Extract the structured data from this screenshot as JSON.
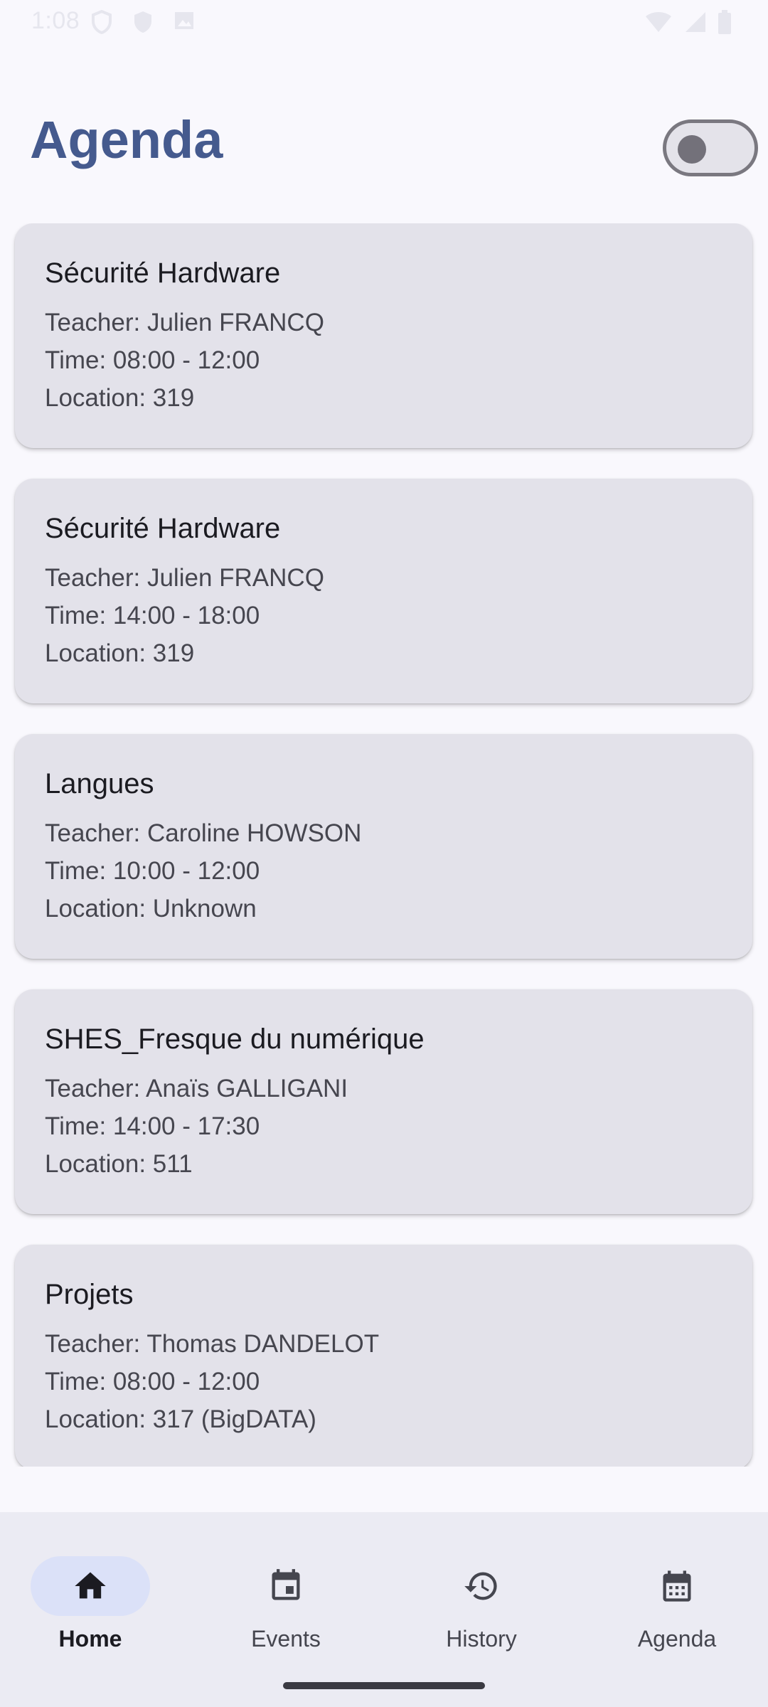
{
  "status_bar": {
    "time": "1:08"
  },
  "header": {
    "title": "Agenda"
  },
  "toggle": {
    "state": "off"
  },
  "events": [
    {
      "title": "Sécurité Hardware",
      "teacher": "Teacher: Julien FRANCQ",
      "time": "Time: 08:00 - 12:00",
      "location": "Location: 319"
    },
    {
      "title": "Sécurité Hardware",
      "teacher": "Teacher: Julien FRANCQ",
      "time": "Time: 14:00 - 18:00",
      "location": "Location: 319"
    },
    {
      "title": "Langues",
      "teacher": "Teacher: Caroline HOWSON",
      "time": "Time: 10:00 - 12:00",
      "location": "Location: Unknown"
    },
    {
      "title": "SHES_Fresque du numérique",
      "teacher": "Teacher: Anaïs GALLIGANI",
      "time": "Time: 14:00 - 17:30",
      "location": "Location: 511"
    },
    {
      "title": "Projets",
      "teacher": "Teacher: Thomas DANDELOT",
      "time": "Time: 08:00 - 12:00",
      "location": "Location: 317 (BigDATA)"
    }
  ],
  "bottom_nav": {
    "items": [
      {
        "label": "Home",
        "icon": "home-icon",
        "active": true
      },
      {
        "label": "Events",
        "icon": "calendar-event-icon",
        "active": false
      },
      {
        "label": "History",
        "icon": "history-icon",
        "active": false
      },
      {
        "label": "Agenda",
        "icon": "calendar-month-icon",
        "active": false
      }
    ]
  },
  "colors": {
    "background": "#f9f8fd",
    "title": "#455a8e",
    "card": "#e3e2ea",
    "nav_background": "#ebebf3",
    "nav_active_pill": "#dbe1f8"
  }
}
